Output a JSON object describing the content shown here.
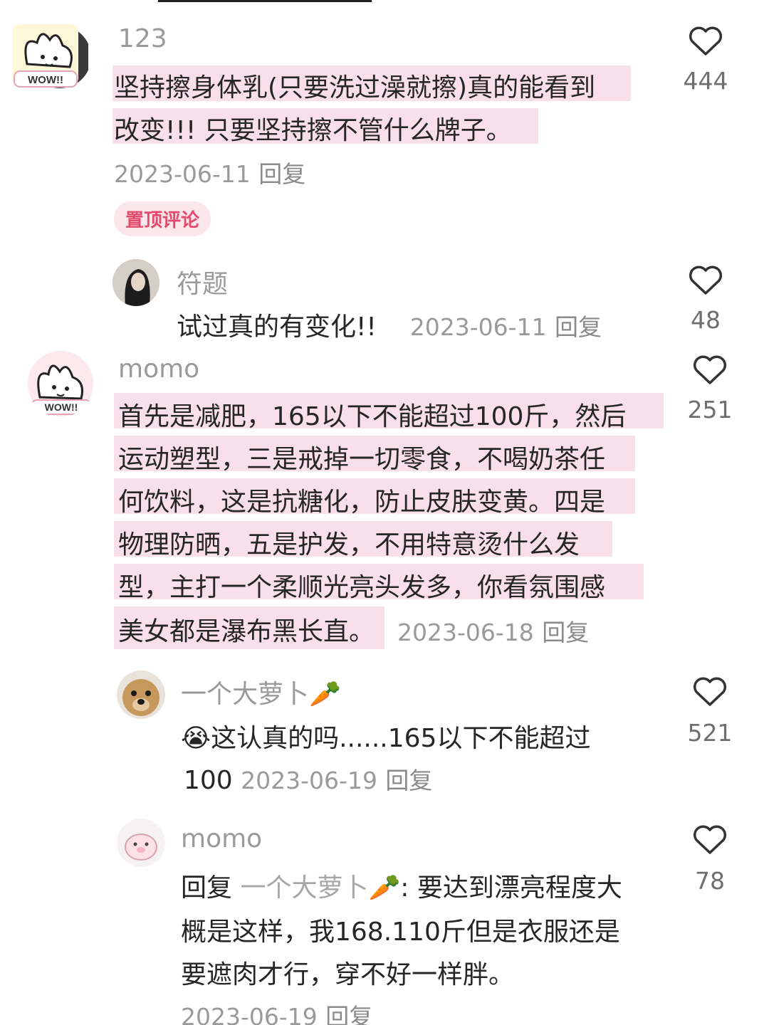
{
  "comments": [
    {
      "username": "123",
      "text_lines": [
        "坚持擦身体乳(只要洗过澡就擦)真的能看到",
        "改变!!! 只要坚持擦不管什么牌子。"
      ],
      "date": "2023-06-11",
      "reply_label": "回复",
      "likes": "444",
      "badge": "置顶评论"
    },
    {
      "username": "符题",
      "text": "试过真的有变化!!",
      "date": "2023-06-11",
      "reply_label": "回复",
      "likes": "48"
    },
    {
      "username": "momo",
      "text_lines": [
        "首先是减肥，165以下不能超过100斤，然后",
        "运动塑型，三是戒掉一切零食，不喝奶茶任",
        "何饮料，这是抗糖化，防止皮肤变黄。四是",
        "物理防晒，五是护发，不用特意烫什么发",
        "型，主打一个柔顺光亮头发多，你看氛围感",
        "美女都是瀑布黑长直。"
      ],
      "date": "2023-06-18",
      "reply_label": "回复",
      "likes": "251"
    },
    {
      "username": "一个大萝卜🥕",
      "text_line1": "😭这认真的吗......165以下不能超过",
      "text_line2": "100",
      "date": "2023-06-19",
      "reply_label": "回复",
      "likes": "521"
    },
    {
      "username": "momo",
      "reply_prefix": "回复",
      "reply_to": "一个大萝卜🥕",
      "text_line1": ": 要达到漂亮程度大",
      "text_line2": "概是这样，我168.110斤但是衣服还是",
      "text_line3": "要遮肉才行，穿不好一样胖。",
      "date": "2023-06-19",
      "reply_label": "回复",
      "likes": "78"
    }
  ],
  "icons": {
    "heart": "heart-outline-icon",
    "heart_stroke_color": "#333333",
    "highlight_color": "#f8dfea",
    "pinned_color": "#e24b6b"
  }
}
